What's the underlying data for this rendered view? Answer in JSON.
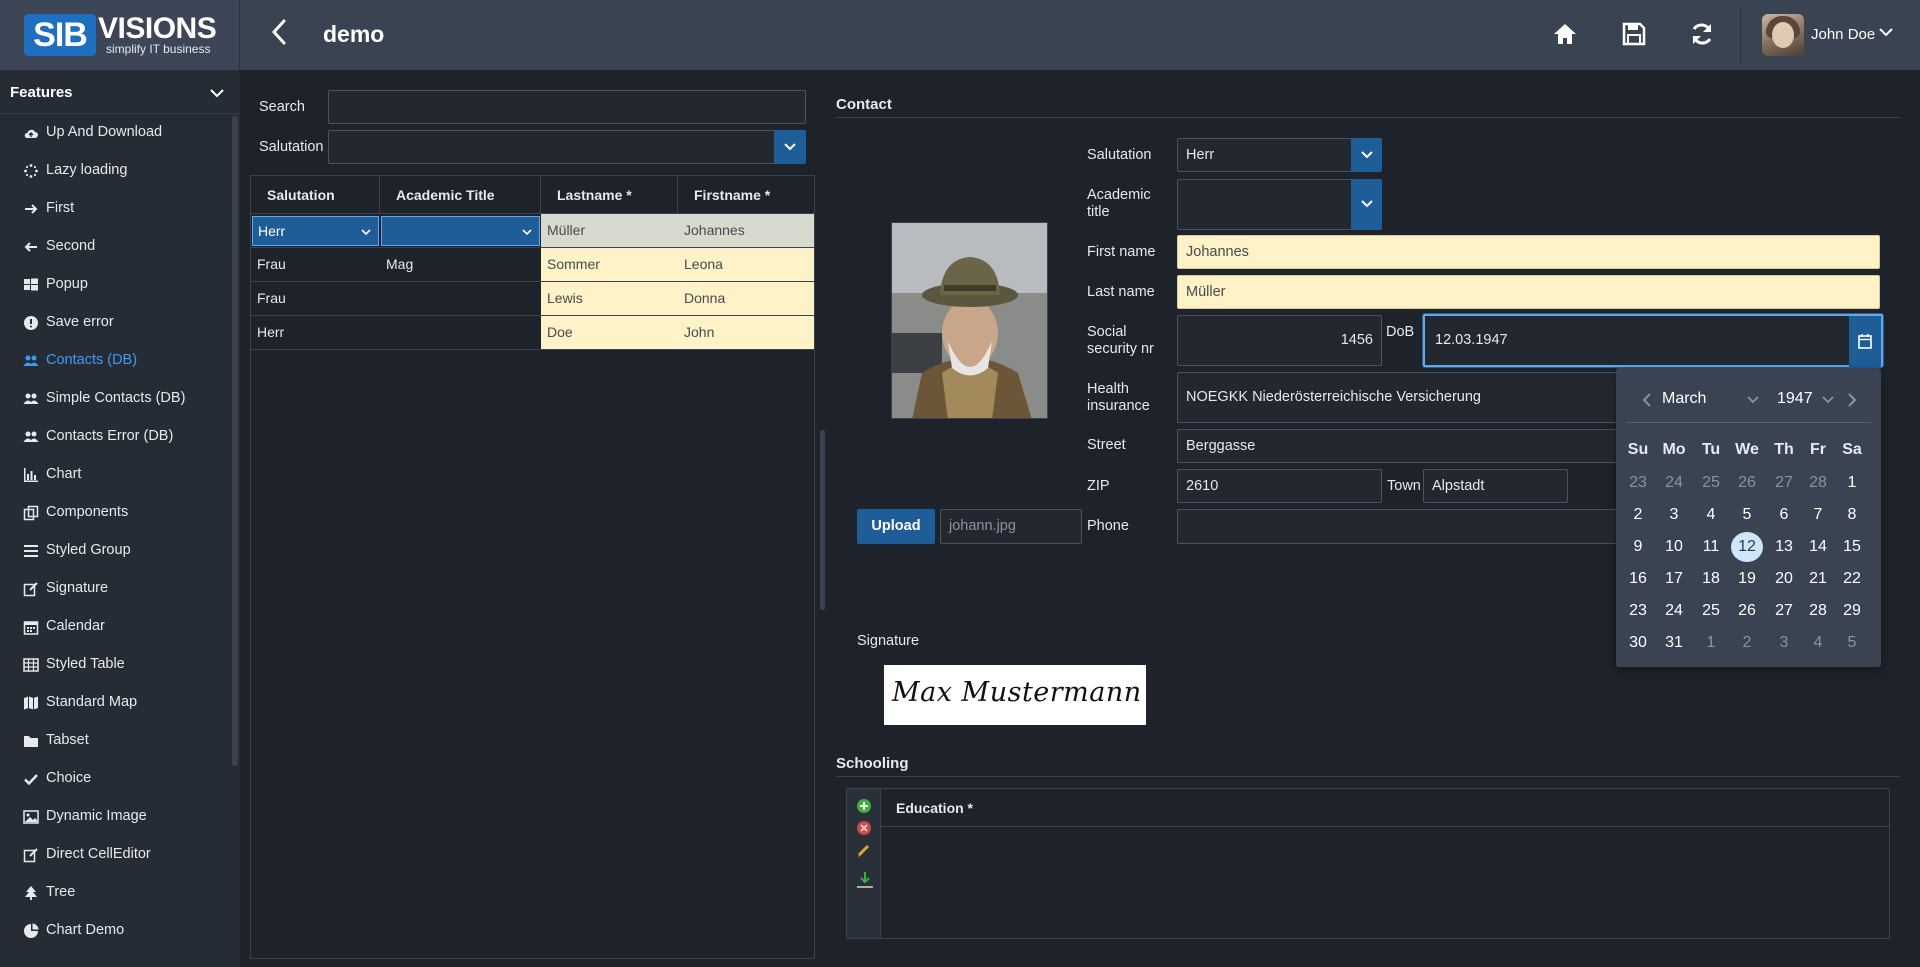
{
  "header": {
    "logo_main": "SIB",
    "logo_rest": "VISIONS",
    "logo_tagline": "simplify IT business",
    "title": "demo",
    "user_name": "John Doe"
  },
  "sidebar": {
    "heading": "Features",
    "active_index": 6,
    "items": [
      {
        "label": "Up And Download",
        "icon": "cloud-upload-icon"
      },
      {
        "label": "Lazy loading",
        "icon": "spinner-icon"
      },
      {
        "label": "First",
        "icon": "arrow-right-icon"
      },
      {
        "label": "Second",
        "icon": "arrow-left-icon"
      },
      {
        "label": "Popup",
        "icon": "windows-icon"
      },
      {
        "label": "Save error",
        "icon": "exclamation-circle-icon"
      },
      {
        "label": "Contacts (DB)",
        "icon": "users-icon"
      },
      {
        "label": "Simple Contacts (DB)",
        "icon": "users-icon"
      },
      {
        "label": "Contacts Error (DB)",
        "icon": "users-icon"
      },
      {
        "label": "Chart",
        "icon": "bar-chart-icon"
      },
      {
        "label": "Components",
        "icon": "clone-icon"
      },
      {
        "label": "Styled Group",
        "icon": "list-icon"
      },
      {
        "label": "Signature",
        "icon": "edit-icon"
      },
      {
        "label": "Calendar",
        "icon": "calendar-icon"
      },
      {
        "label": "Styled Table",
        "icon": "table-icon"
      },
      {
        "label": "Standard Map",
        "icon": "map-icon"
      },
      {
        "label": "Tabset",
        "icon": "folder-icon"
      },
      {
        "label": "Choice",
        "icon": "check-icon"
      },
      {
        "label": "Dynamic Image",
        "icon": "image-icon"
      },
      {
        "label": "Direct CellEditor",
        "icon": "edit-icon"
      },
      {
        "label": "Tree",
        "icon": "tree-icon"
      },
      {
        "label": "Chart Demo",
        "icon": "pie-chart-icon"
      }
    ]
  },
  "filter": {
    "search_label": "Search",
    "search_value": "",
    "salutation_label": "Salutation",
    "salutation_value": ""
  },
  "table": {
    "columns": [
      "Salutation",
      "Academic Title",
      "Lastname *",
      "Firstname *"
    ],
    "rows": [
      {
        "salutation": "Herr",
        "title": "",
        "lastname": "Müller",
        "firstname": "Johannes"
      },
      {
        "salutation": "Frau",
        "title": "Mag",
        "lastname": "Sommer",
        "firstname": "Leona"
      },
      {
        "salutation": "Frau",
        "title": "",
        "lastname": "Lewis",
        "firstname": "Donna"
      },
      {
        "salutation": "Herr",
        "title": "",
        "lastname": "Doe",
        "firstname": "John"
      }
    ]
  },
  "contact": {
    "section_title": "Contact",
    "salutation_label": "Salutation",
    "salutation_value": "Herr",
    "academic_label_1": "Academic",
    "academic_label_2": "title",
    "academic_value": "",
    "firstname_label": "First name",
    "firstname_value": "Johannes",
    "lastname_label": "Last name",
    "lastname_value": "Müller",
    "ssn_label_1": "Social",
    "ssn_label_2": "security nr",
    "ssn_value": "1456",
    "dob_label": "DoB",
    "dob_value": "12.03.1947",
    "health_label_1": "Health",
    "health_label_2": "insurance",
    "health_value": "NOEGKK Niederösterreichische Versicherung",
    "street_label": "Street",
    "street_value": "Berggasse",
    "zip_label": "ZIP",
    "zip_value": "2610",
    "town_label": "Town",
    "town_value": "Alpstadt",
    "phone_label": "Phone",
    "phone_value": "",
    "upload_label": "Upload",
    "file_name": "johann.jpg",
    "signature_label": "Signature",
    "signature_text": "Max Mustermann"
  },
  "calendar": {
    "month": "March",
    "year": "1947",
    "weekdays": [
      "Su",
      "Mo",
      "Tu",
      "We",
      "Th",
      "Fr",
      "Sa"
    ],
    "weeks": [
      [
        "23",
        "24",
        "25",
        "26",
        "27",
        "28",
        "1"
      ],
      [
        "2",
        "3",
        "4",
        "5",
        "6",
        "7",
        "8"
      ],
      [
        "9",
        "10",
        "11",
        "12",
        "13",
        "14",
        "15"
      ],
      [
        "16",
        "17",
        "18",
        "19",
        "20",
        "21",
        "22"
      ],
      [
        "23",
        "24",
        "25",
        "26",
        "27",
        "28",
        "29"
      ],
      [
        "30",
        "31",
        "1",
        "2",
        "3",
        "4",
        "5"
      ]
    ],
    "selected": "12"
  },
  "schooling": {
    "section_title": "Schooling",
    "column": "Education *"
  },
  "colors": {
    "accent": "#1f5d99",
    "active_link": "#3e9cf0",
    "required_field": "#fdf2c8"
  }
}
